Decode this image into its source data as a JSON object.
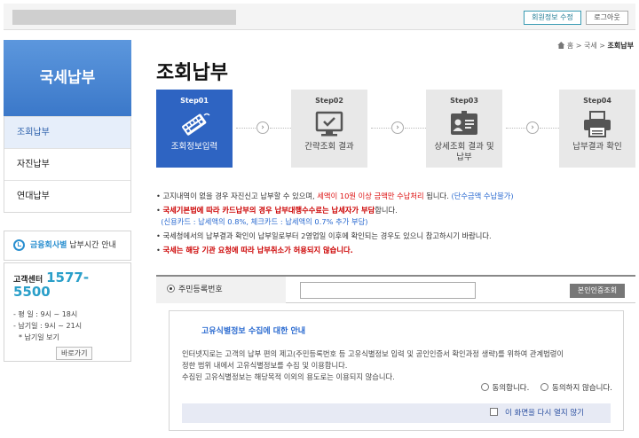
{
  "header": {
    "member_edit_label": "회원정보 수정",
    "logout_label": "로그아웃"
  },
  "sidebar": {
    "title": "국세납부",
    "items": [
      {
        "label": "조회납부",
        "active": true
      },
      {
        "label": "자진납부",
        "active": false
      },
      {
        "label": "연대납부",
        "active": false
      }
    ],
    "time_notice": {
      "highlight": "금융회사별",
      "text": " 납부시간 안내"
    },
    "call_center": {
      "label": "고객센터",
      "number": "1577-5500",
      "weekday": "- 평   일 : 9시 ~ 18시",
      "holiday": "- 납기일 : 9시 ~ 21시",
      "holiday_note": "* 납기일 보기",
      "shortcut_label": "바로가기"
    }
  },
  "breadcrumb": {
    "home": "홈",
    "sep": ">",
    "level1": "국세",
    "current": "조회납부"
  },
  "page_title": "조회납부",
  "steps": [
    {
      "no": "Step01",
      "label": "조회정보입력",
      "icon": "keyboard-icon",
      "active": true
    },
    {
      "no": "Step02",
      "label": "간략조회 결과",
      "icon": "monitor-check-icon",
      "active": false
    },
    {
      "no": "Step03",
      "label": "상세조회 결과 및 납부",
      "icon": "id-card-icon",
      "active": false
    },
    {
      "no": "Step04",
      "label": "납부결과 확인",
      "icon": "printer-icon",
      "active": false
    }
  ],
  "notices": {
    "n1_a": "고지내역이 없을 경우 자진신고 납부할 수 있으며, ",
    "n1_red": "세액이 10원 이상 금액만 수납처리",
    "n1_b": " 됩니다. ",
    "n1_blue": "(단수금액 수납불가)",
    "n2_red": "국세기본법에 따라 카드납부의 경우 납부대행수수료는 납세자가 부담",
    "n2_b": "합니다.",
    "n2_sub": "(신용카드 : 납세액의 0.8%, 체크카드 : 납세액의 0.7% 추가 부담)",
    "n3": "국세청에서의 납부결과 확인이 납부일로부터 2영업일 이후에 확인되는 경우도 있으니 참고하시기 바랍니다.",
    "n4": "국세는 해당 기관 요청에 따라 납부취소가 허용되지 않습니다."
  },
  "id_input": {
    "label": "주민등록번호",
    "value": "",
    "auth_label": "본인인증조회"
  },
  "consent": {
    "title": "고유식별정보 수집에 대한 안내",
    "body1": "인터넷지로는 고객의 납부 편의 제고(주민등록번호 등 고유식별정보 입력 및 공인인증서 확인과정 생략)를 위하여 관계법령이",
    "body2": "정한 범위 내에서 고유식별정보를 수집 및 이용합니다.",
    "body3": "수집된 고유식별정보는 해당목적 이외의 용도로는 이용되지 않습니다.",
    "agree": "동의합니다.",
    "disagree": "동의하지 않습니다.",
    "dont_show": "이 화면을 다시 열지 않기"
  }
}
